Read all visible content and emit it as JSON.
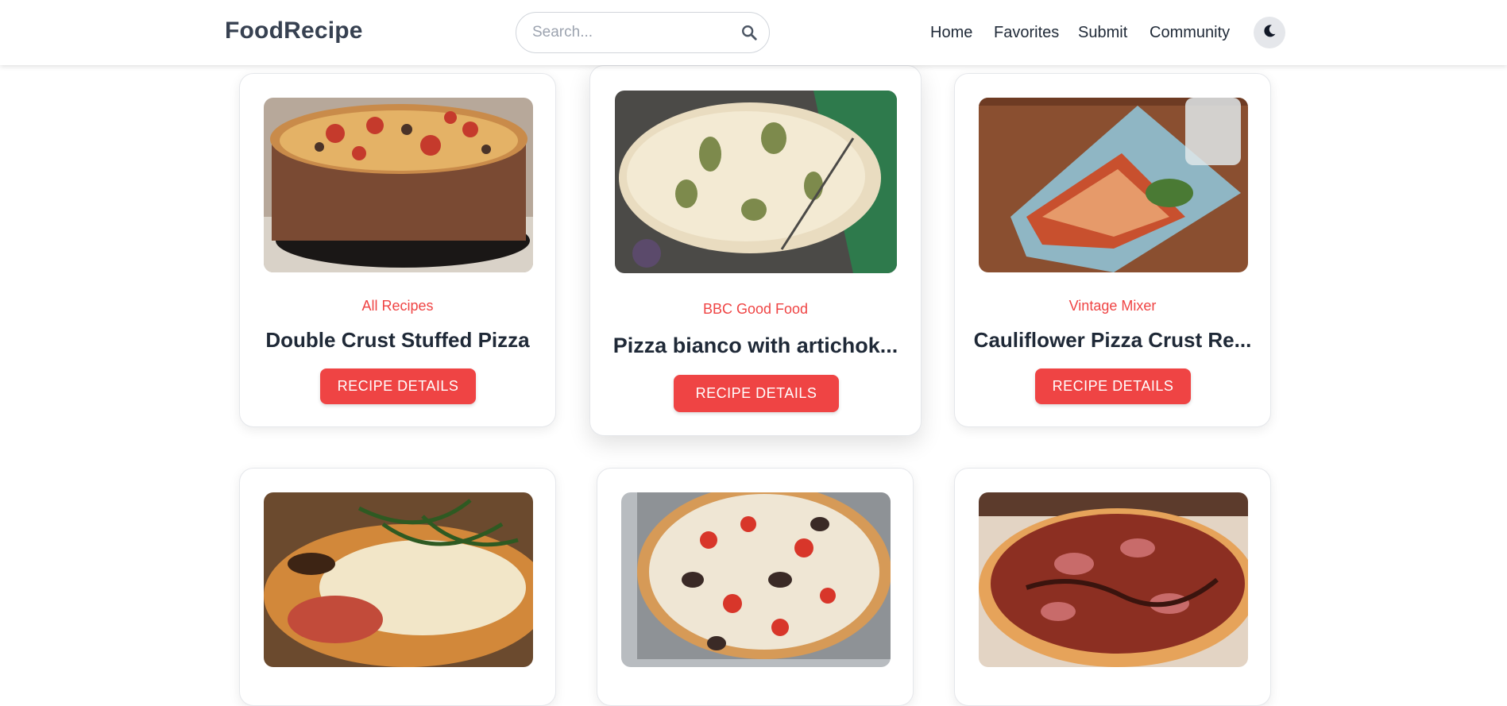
{
  "header": {
    "brand": "FoodRecipe",
    "search_placeholder": "Search...",
    "nav": [
      "Home",
      "Favorites",
      "Submit",
      "Community"
    ]
  },
  "cards": [
    {
      "source": "All Recipes",
      "title": "Double Crust Stuffed Pizza",
      "button": "RECIPE DETAILS"
    },
    {
      "source": "BBC Good Food",
      "title": "Pizza bianco with artichok...",
      "button": "RECIPE DETAILS"
    },
    {
      "source": "Vintage Mixer",
      "title": "Cauliflower Pizza Crust Re...",
      "button": "RECIPE DETAILS"
    },
    {
      "source": "",
      "title": "",
      "button": ""
    },
    {
      "source": "",
      "title": "",
      "button": ""
    },
    {
      "source": "",
      "title": "",
      "button": ""
    }
  ],
  "colors": {
    "accent": "#ef4444",
    "text": "#1f2937",
    "brand": "#374151"
  }
}
